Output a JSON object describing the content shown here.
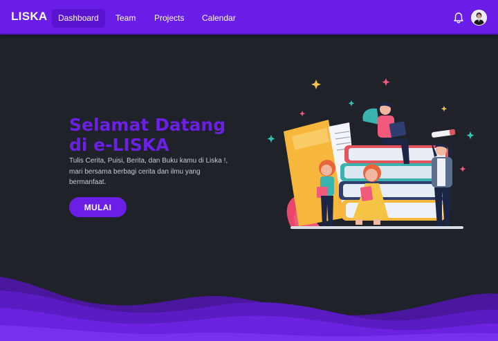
{
  "app": {
    "brand": "LISKA"
  },
  "nav": {
    "items": [
      {
        "label": "Dashboard",
        "active": true
      },
      {
        "label": "Team",
        "active": false
      },
      {
        "label": "Projects",
        "active": false
      },
      {
        "label": "Calendar",
        "active": false
      }
    ],
    "icons": {
      "notifications": "bell-icon",
      "profile": "avatar"
    }
  },
  "hero": {
    "title_line1": "Selamat Datang",
    "title_line2": "di e-LISKA",
    "subtitle_line1": "Tulis Cerita, Puisi, Berita, dan Buku kamu di Liska !,",
    "subtitle_line2": "mari bersama berbagi cerita dan ilmu yang",
    "subtitle_line3": "bermanfaat.",
    "cta_label": "MULAI"
  },
  "colors": {
    "primary": "#6a1de6",
    "background": "#1f2228",
    "title": "#6b20e6",
    "wave": "#5b1ac4"
  }
}
